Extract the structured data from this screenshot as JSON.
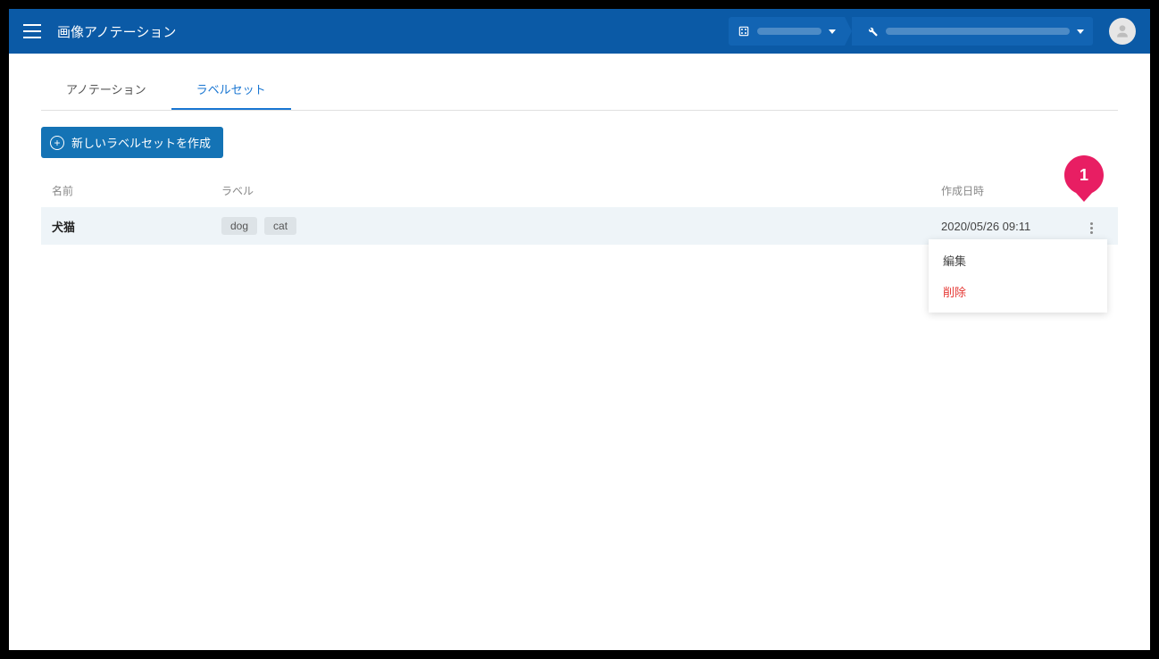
{
  "header": {
    "title": "画像アノテーション"
  },
  "tabs": {
    "annotation": "アノテーション",
    "labelset": "ラベルセット"
  },
  "buttons": {
    "create_labelset": "新しいラベルセットを作成"
  },
  "table": {
    "headers": {
      "name": "名前",
      "label": "ラベル",
      "created_at": "作成日時"
    },
    "rows": [
      {
        "name": "犬猫",
        "labels": [
          "dog",
          "cat"
        ],
        "created_at": "2020/05/26 09:11"
      }
    ]
  },
  "menu": {
    "edit": "編集",
    "delete": "削除"
  },
  "annotation": {
    "badge": "1"
  }
}
